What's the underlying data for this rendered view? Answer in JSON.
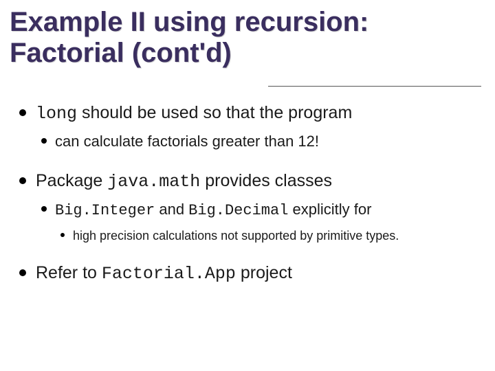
{
  "title_line1": "Example II using recursion:",
  "title_line2": "Factorial (cont'd)",
  "bullets": {
    "b1_code": "long",
    "b1_text": " should be used so that the program",
    "b1_sub": "can calculate factorials greater than 12!",
    "b2_pre": "Package ",
    "b2_code": "java.math",
    "b2_post": " provides classes",
    "b2_sub_code1": "Big.Integer",
    "b2_sub_mid": " and ",
    "b2_sub_code2": "Big.Decimal",
    "b2_sub_post": "  explicitly for",
    "b2_subsub": "high precision calculations not supported by primitive types.",
    "b3_pre": "Refer to ",
    "b3_code": "Factorial.App",
    "b3_post": " project"
  }
}
